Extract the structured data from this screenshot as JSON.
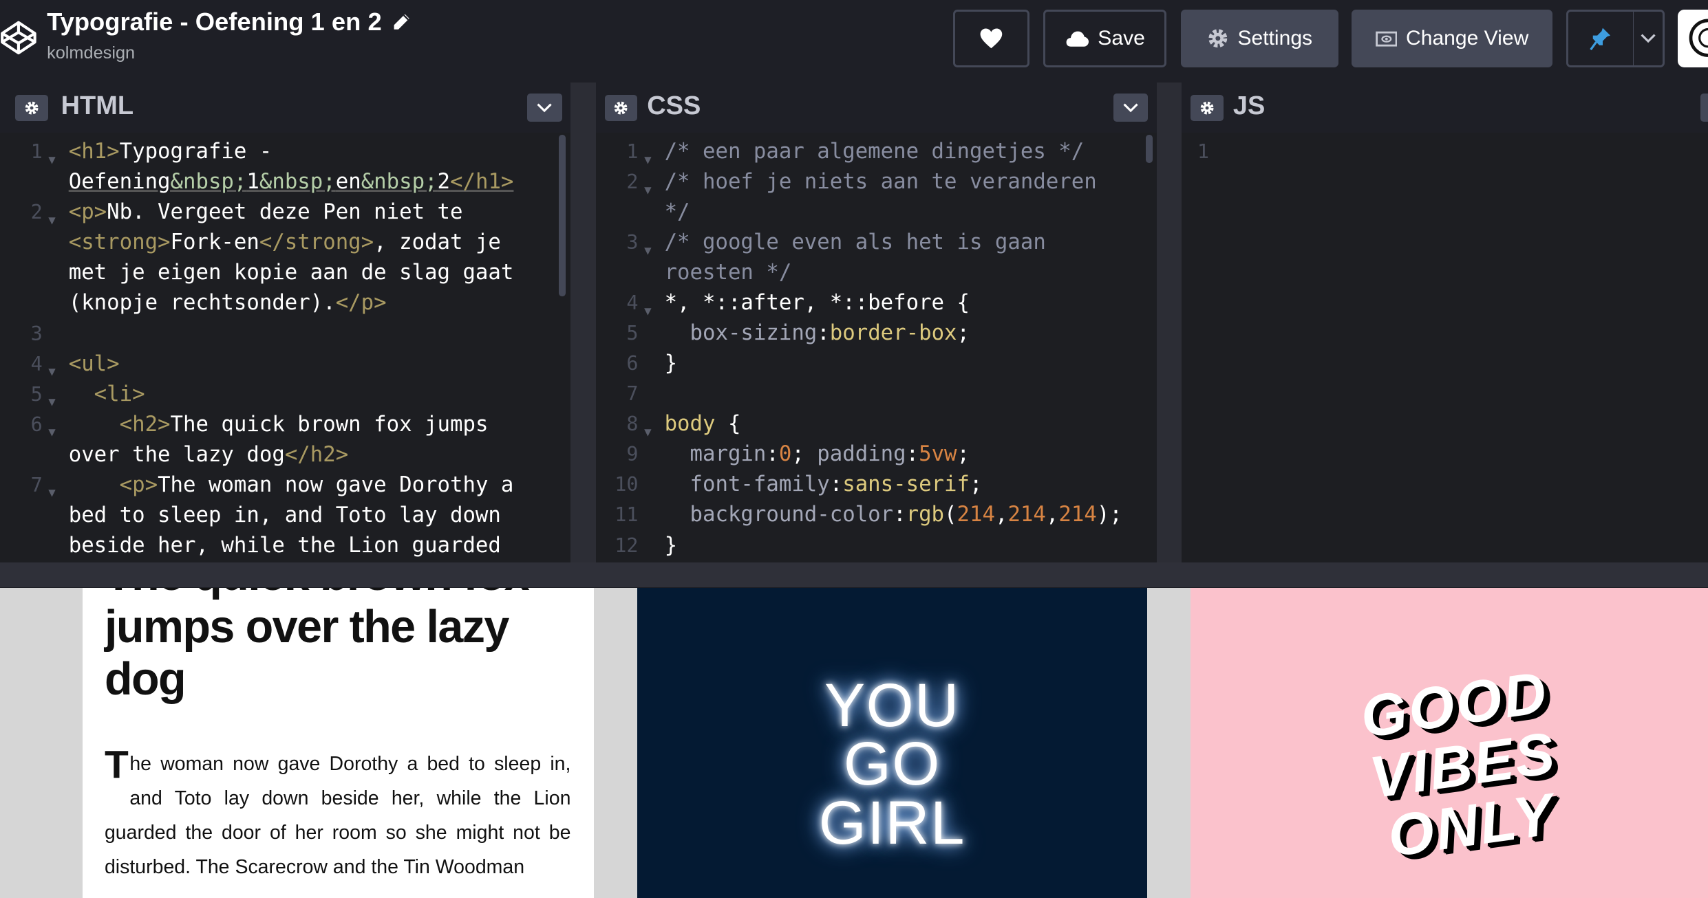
{
  "header": {
    "title": "Typografie - Oefening 1 en 2",
    "author": "kolmdesign",
    "buttons": {
      "save": "Save",
      "settings": "Settings",
      "change_view": "Change View"
    }
  },
  "editors": {
    "html": {
      "name": "HTML",
      "line_numbers": [
        "1",
        "2",
        "3",
        "4",
        "5",
        "6",
        "7"
      ]
    },
    "css": {
      "name": "CSS",
      "line_numbers": [
        "1",
        "2",
        "3",
        "4",
        "5",
        "6",
        "7",
        "8",
        "9",
        "10",
        "11",
        "12"
      ]
    },
    "js": {
      "name": "JS",
      "line_numbers": [
        "1"
      ]
    }
  },
  "preview": {
    "card1": {
      "heading": "The quick brown fox jumps over the lazy dog",
      "dropcap": "T",
      "paragraph": "he woman now gave Dorothy a bed to sleep in, and Toto lay down beside her, while the Lion guarded the door of her room so she might not be disturbed. The Scarecrow and the Tin Woodman"
    },
    "card2": {
      "lines": [
        "YOU",
        "GO",
        "GIRL"
      ]
    },
    "card3": {
      "lines": [
        "GOOD",
        "VIBES",
        "ONLY"
      ]
    }
  },
  "colors": {
    "topbar": "#1e1f26",
    "editor_bg": "#1d1e22",
    "button_gray": "#444857",
    "neon_card": "#041a33",
    "pink_card": "#fbc2cc",
    "preview_bg": "#d6d6d6"
  }
}
